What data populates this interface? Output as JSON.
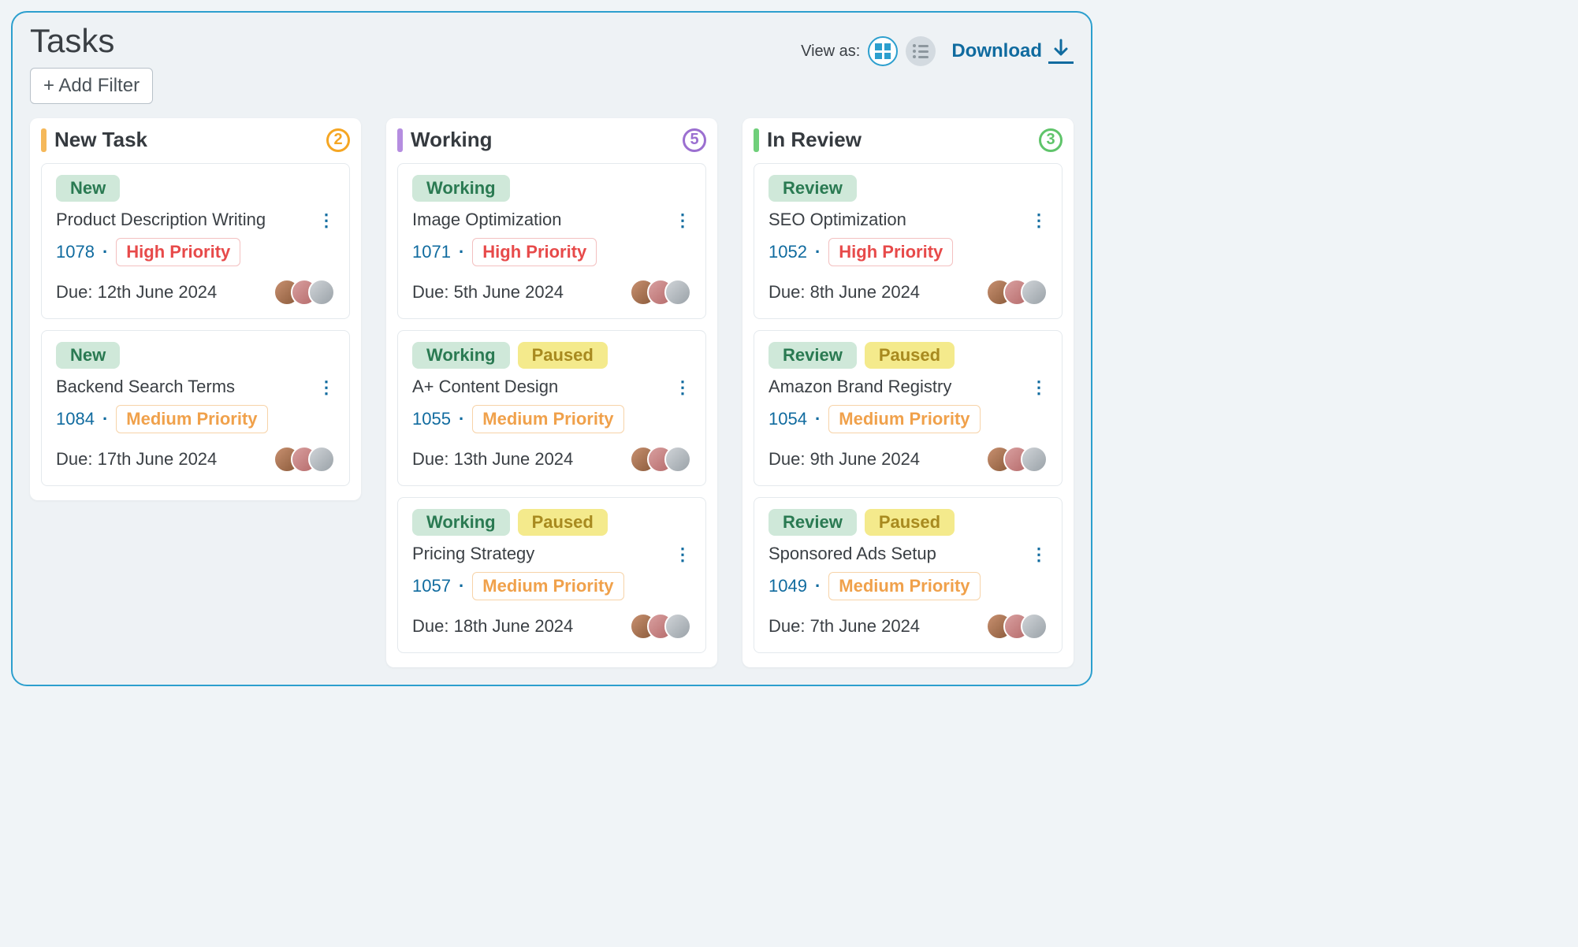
{
  "header": {
    "title": "Tasks",
    "add_filter": "+ Add Filter",
    "view_as": "View as:",
    "download": "Download"
  },
  "columns": [
    {
      "key": "new",
      "title": "New Task",
      "bar_color": "#f5b85a",
      "count": "2",
      "count_color": "#f5a623",
      "tasks": [
        {
          "status": "New",
          "paused": false,
          "title": "Product Description Writing",
          "id": "1078",
          "priority": "High Priority",
          "priority_level": "high",
          "due": "Due: 12th June 2024"
        },
        {
          "status": "New",
          "paused": false,
          "title": "Backend Search Terms",
          "id": "1084",
          "priority": "Medium Priority",
          "priority_level": "medium",
          "due": "Due: 17th June 2024"
        }
      ]
    },
    {
      "key": "working",
      "title": "Working",
      "bar_color": "#b58de0",
      "count": "5",
      "count_color": "#9b6fd0",
      "tasks": [
        {
          "status": "Working",
          "paused": false,
          "title": "Image Optimization",
          "id": "1071",
          "priority": "High Priority",
          "priority_level": "high",
          "due": "Due: 5th June 2024"
        },
        {
          "status": "Working",
          "paused": true,
          "paused_label": "Paused",
          "title": "A+ Content Design",
          "id": "1055",
          "priority": "Medium Priority",
          "priority_level": "medium",
          "due": "Due: 13th June 2024"
        },
        {
          "status": "Working",
          "paused": true,
          "paused_label": "Paused",
          "title": "Pricing Strategy",
          "id": "1057",
          "priority": "Medium Priority",
          "priority_level": "medium",
          "due": "Due: 18th June 2024"
        }
      ]
    },
    {
      "key": "review",
      "title": "In Review",
      "bar_color": "#6fcf7a",
      "count": "3",
      "count_color": "#5fc46a",
      "tasks": [
        {
          "status": "Review",
          "paused": false,
          "title": "SEO Optimization",
          "id": "1052",
          "priority": "High Priority",
          "priority_level": "high",
          "due": "Due: 8th June 2024"
        },
        {
          "status": "Review",
          "paused": true,
          "paused_label": "Paused",
          "title": "Amazon Brand Registry",
          "id": "1054",
          "priority": "Medium Priority",
          "priority_level": "medium",
          "due": "Due: 9th June 2024"
        },
        {
          "status": "Review",
          "paused": true,
          "paused_label": "Paused",
          "title": "Sponsored Ads Setup",
          "id": "1049",
          "priority": "Medium Priority",
          "priority_level": "medium",
          "due": "Due: 7th June 2024"
        }
      ]
    }
  ]
}
